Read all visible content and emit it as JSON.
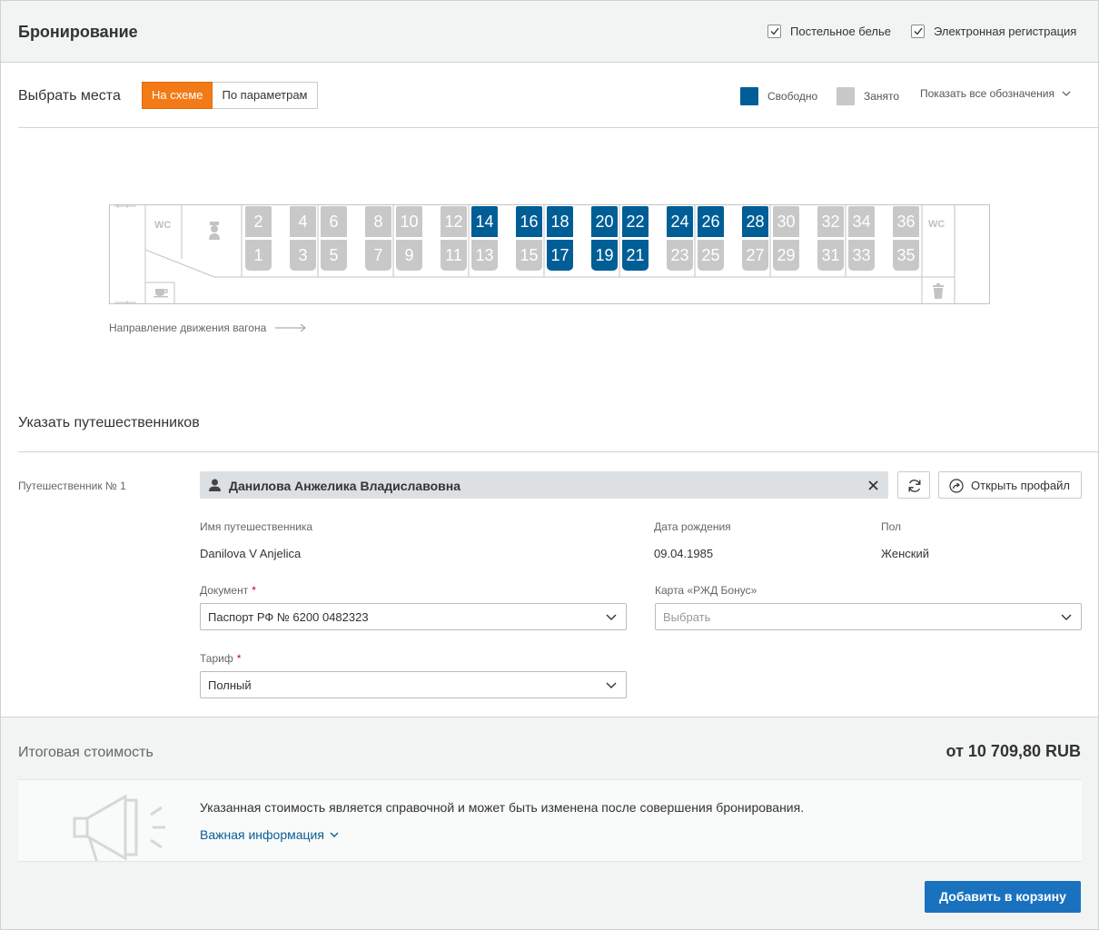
{
  "header": {
    "title": "Бронирование",
    "bedding_label": "Постельное белье",
    "eregistration_label": "Электронная регистрация"
  },
  "seats_section": {
    "title": "Выбрать места",
    "toggle_scheme": "На схеме",
    "toggle_params": "По параметрам",
    "legend_free": "Свободно",
    "legend_occupied": "Занято",
    "legend_show_all": "Показать все обозначения",
    "colors": {
      "free": "#005e97",
      "occupied": "#c8c8c8",
      "accent": "#f27a17"
    },
    "wc_label": "WC",
    "seats": [
      {
        "top": "2",
        "bottom": "1",
        "top_free": false,
        "bottom_free": false
      },
      {
        "top": "4",
        "bottom": "3",
        "top_free": false,
        "bottom_free": false
      },
      {
        "top": "6",
        "bottom": "5",
        "top_free": false,
        "bottom_free": false
      },
      {
        "top": "8",
        "bottom": "7",
        "top_free": false,
        "bottom_free": false
      },
      {
        "top": "10",
        "bottom": "9",
        "top_free": false,
        "bottom_free": false
      },
      {
        "top": "12",
        "bottom": "11",
        "top_free": false,
        "bottom_free": false
      },
      {
        "top": "14",
        "bottom": "13",
        "top_free": true,
        "bottom_free": false
      },
      {
        "top": "16",
        "bottom": "15",
        "top_free": true,
        "bottom_free": false
      },
      {
        "top": "18",
        "bottom": "17",
        "top_free": true,
        "bottom_free": true
      },
      {
        "top": "20",
        "bottom": "19",
        "top_free": true,
        "bottom_free": true
      },
      {
        "top": "22",
        "bottom": "21",
        "top_free": true,
        "bottom_free": true
      },
      {
        "top": "24",
        "bottom": "23",
        "top_free": true,
        "bottom_free": false
      },
      {
        "top": "26",
        "bottom": "25",
        "top_free": true,
        "bottom_free": false
      },
      {
        "top": "28",
        "bottom": "27",
        "top_free": true,
        "bottom_free": false
      },
      {
        "top": "30",
        "bottom": "29",
        "top_free": false,
        "bottom_free": false
      },
      {
        "top": "32",
        "bottom": "31",
        "top_free": false,
        "bottom_free": false
      },
      {
        "top": "34",
        "bottom": "33",
        "top_free": false,
        "bottom_free": false
      },
      {
        "top": "36",
        "bottom": "35",
        "top_free": false,
        "bottom_free": false
      }
    ],
    "direction_label": "Направление движения вагона"
  },
  "travellers": {
    "title": "Указать путешественников",
    "traveller_label": "Путешественник № 1",
    "name": "Данилова Анжелика Владиславовна",
    "open_profile": "Открыть профайл",
    "name_label": "Имя путешественника",
    "name_value": "Danilova V Anjelica",
    "dob_label": "Дата рождения",
    "dob_value": "09.04.1985",
    "gender_label": "Пол",
    "gender_value": "Женский",
    "document_label": "Документ",
    "document_value": "Паспорт РФ № 6200 0482323",
    "bonus_label": "Карта «РЖД Бонус»",
    "bonus_placeholder": "Выбрать",
    "tariff_label": "Тариф",
    "tariff_value": "Полный",
    "required_mark": "*"
  },
  "total": {
    "label": "Итоговая стоимость",
    "price": "от 10 709,80 RUB",
    "notice_text": "Указанная стоимость является справочной и может быть изменена после совершения бронирования.",
    "notice_link": "Важная информация",
    "add_to_cart": "Добавить в корзину"
  }
}
